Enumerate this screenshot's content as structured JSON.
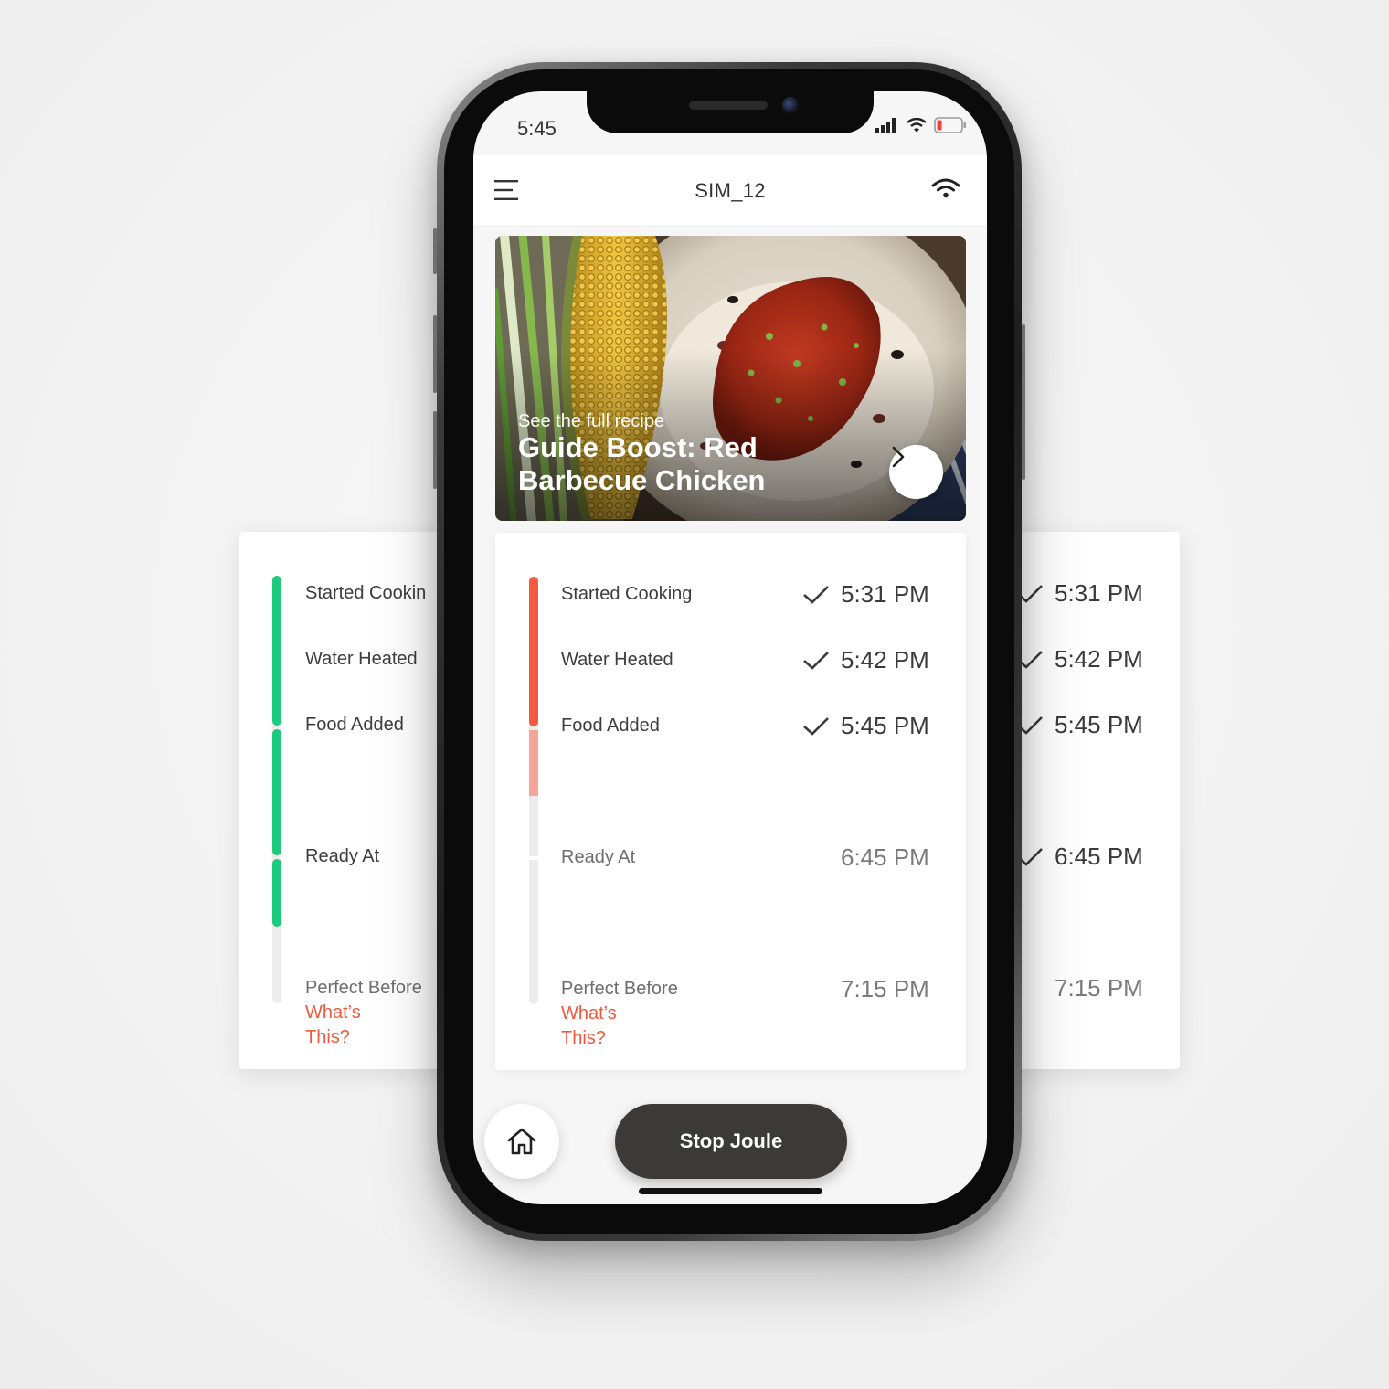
{
  "status_bar": {
    "time": "5:45"
  },
  "header": {
    "title": "SIM_12"
  },
  "hero": {
    "kicker": "See the full recipe",
    "title": "Guide Boost: Red Barbecue Chicken"
  },
  "timeline": {
    "rows": [
      {
        "label": "Started Cooking",
        "time": "5:31 PM",
        "done": true
      },
      {
        "label": "Water Heated",
        "time": "5:42 PM",
        "done": true
      },
      {
        "label": "Food Added",
        "time": "5:45 PM",
        "done": true
      },
      {
        "label": "Ready At",
        "time": "6:45 PM",
        "done": false
      },
      {
        "label": "Perfect Before",
        "time": "7:15 PM",
        "done": false
      }
    ],
    "link": "What’s\nThis?"
  },
  "side_left": {
    "rows": [
      "Started Cookin",
      "Water Heated",
      "Food Added",
      "Ready At",
      "Perfect Before"
    ],
    "link": "What’s\nThis?"
  },
  "side_right": {
    "times": [
      "5:31 PM",
      "5:42 PM",
      "5:45 PM",
      "6:45 PM",
      "7:15 PM"
    ]
  },
  "bottom": {
    "stop_label": "Stop Joule"
  },
  "colors": {
    "accent_red": "#f45b41",
    "accent_red_light": "#f4a597",
    "accent_green": "#1ccb7c",
    "track_gray": "#ececec",
    "link": "#ef5a3f",
    "button_dark": "#3b3a38"
  },
  "icons": [
    "menu-icon",
    "wifi-icon",
    "chevron-right-icon",
    "check-icon",
    "home-icon",
    "signal-icon",
    "battery-icon"
  ]
}
